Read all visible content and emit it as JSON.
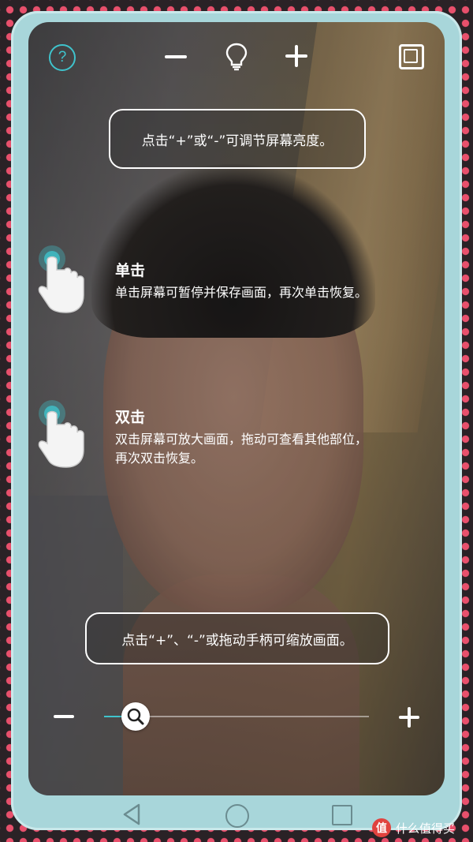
{
  "toolbar": {
    "help_icon": "question-circle-icon",
    "help_glyph": "?",
    "brightness_down_icon": "minus-icon",
    "brightness_icon": "lightbulb-icon",
    "brightness_up_icon": "plus-icon",
    "fullscreen_icon": "square-frame-icon"
  },
  "tips": {
    "brightness": "点击“+”或“-”可调节屏幕亮度。",
    "single_tap_title": "单击",
    "single_tap_text": "单击屏幕可暂停并保存画面，再次单击恢复。",
    "double_tap_title": "双击",
    "double_tap_text_line1": "双击屏幕可放大画面，拖动可查看其他部位，",
    "double_tap_text_line2": "再次双击恢复。",
    "zoom": "点击“+”、“-”或拖动手柄可缩放画面。"
  },
  "zoom_slider": {
    "value": 0.12,
    "minus_icon": "minus-icon",
    "plus_icon": "plus-icon",
    "thumb_icon": "magnifier-icon"
  },
  "navbar": {
    "back_icon": "triangle-back-icon",
    "home_icon": "circle-home-icon",
    "recent_icon": "square-recent-icon"
  },
  "watermark": {
    "badge": "值",
    "text": "什么值得买"
  },
  "colors": {
    "accent": "#3fc3cc",
    "frame": "#a8d6da",
    "dots": "#e8506c"
  }
}
